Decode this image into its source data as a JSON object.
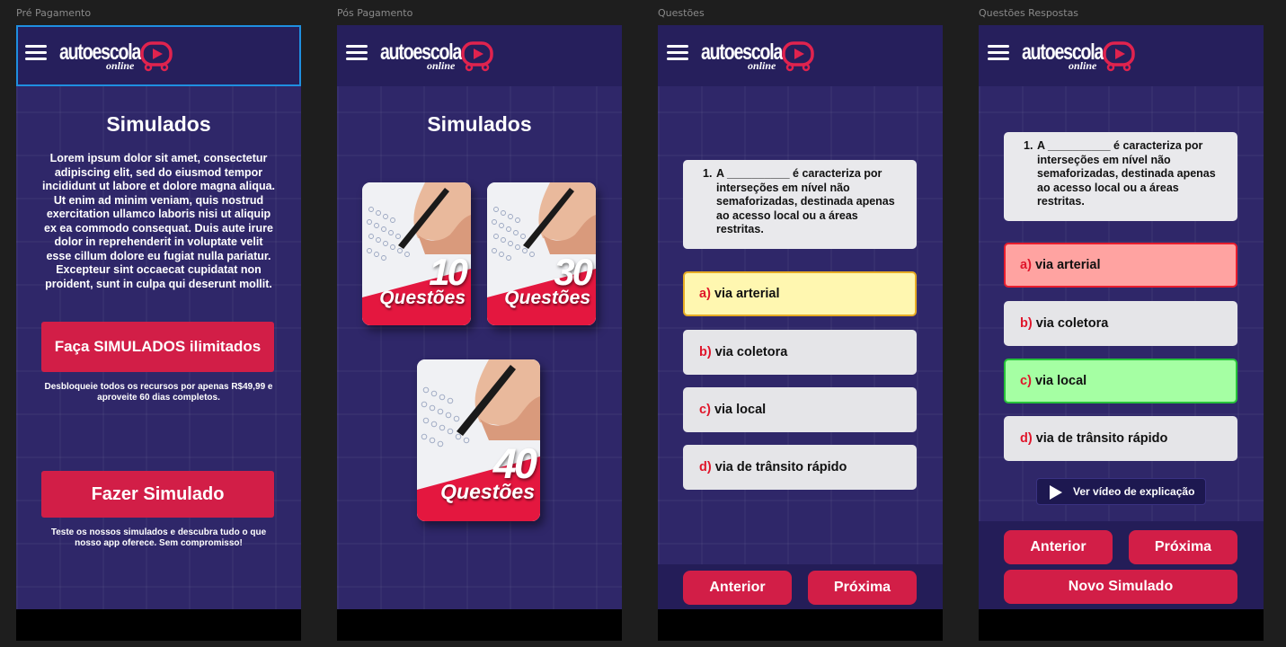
{
  "brand": {
    "logo_main": "autoescola",
    "logo_sub": "online"
  },
  "frames": {
    "pre": {
      "label": "Pré Pagamento"
    },
    "pos": {
      "label": "Pós Pagamento"
    },
    "questoes": {
      "label": "Questões"
    },
    "respostas": {
      "label": "Questões Respostas"
    }
  },
  "pre": {
    "title": "Simulados",
    "description": "Lorem ipsum dolor sit amet, consectetur adipiscing elit, sed do eiusmod tempor incididunt ut labore et dolore magna aliqua. Ut enim ad minim veniam, quis nostrud exercitation ullamco laboris nisi ut aliquip ex ea commodo consequat. Duis aute irure dolor in reprehenderit in voluptate velit esse cillum dolore eu fugiat nulla pariatur. Excepteur sint occaecat cupidatat non proident, sunt in culpa qui deserunt mollit.",
    "unlimited_button": "Faça SIMULADOS ilimitados",
    "unlock_note": "Desbloqueie todos os recursos por apenas R$49,99 e aproveite 60 dias completos.",
    "simulate_button": "Fazer Simulado",
    "trial_note": "Teste os nossos simulados e descubra tudo o que nosso app oferece. Sem compromisso!"
  },
  "pos": {
    "title": "Simulados",
    "cards": [
      {
        "number": "10",
        "word": "Questões"
      },
      {
        "number": "30",
        "word": "Questões"
      },
      {
        "number": "40",
        "word": "Questões"
      }
    ]
  },
  "quiz": {
    "question_number": "1.",
    "question_text": "A __________ é caracteriza por interseções em nível não semaforizadas, destinada apenas ao acesso local ou a áreas restritas.",
    "options": [
      {
        "letter": "a)",
        "text": "via arterial"
      },
      {
        "letter": "b)",
        "text": "via coletora"
      },
      {
        "letter": "c)",
        "text": "via local"
      },
      {
        "letter": "d)",
        "text": "via de trânsito rápido"
      }
    ],
    "prev_button": "Anterior",
    "next_button": "Próxima",
    "video_button": "Ver vídeo de explicação",
    "new_simulation_button": "Novo Simulado"
  },
  "colors": {
    "background": "#2f2769",
    "accent": "#d21e47",
    "selected": "#fff7b0",
    "wrong": "#ffa3a1",
    "correct": "#a5ffa3"
  },
  "icons": [
    "hamburger-menu-icon",
    "logo-play-icon",
    "play-icon"
  ]
}
